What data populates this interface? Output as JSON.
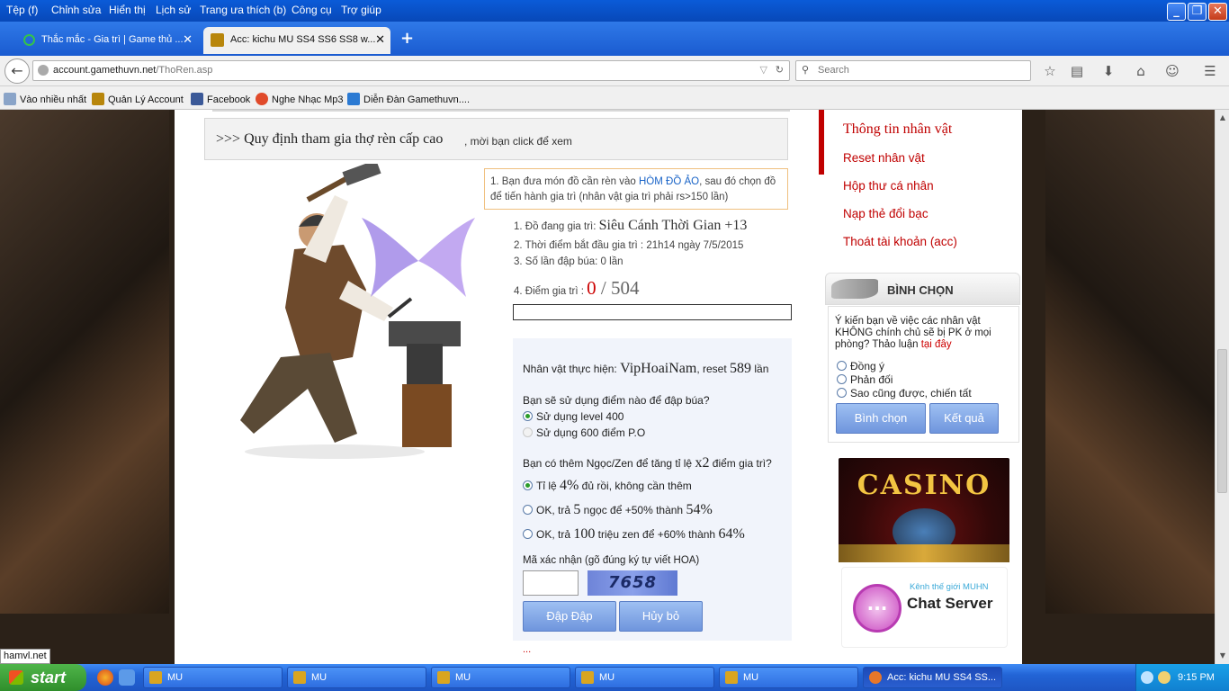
{
  "menubar": {
    "items": [
      "Tệp (f)",
      "Chỉnh sửa",
      "Hiển thị",
      "Lịch sử",
      "Trang ưa thích (b)",
      "Công cụ",
      "Trợ giúp"
    ]
  },
  "tabs": [
    {
      "label": "Thắc mắc - Gia trì | Game thủ ..."
    },
    {
      "label": "Acc: kichu MU SS4 SS6 SS8 w..."
    }
  ],
  "nav": {
    "url_domain": "account.gamethuvn.net",
    "url_path": "/ThoRen.asp",
    "search_placeholder": "Search"
  },
  "bookmarks": [
    "Vào nhiều nhất",
    "Quản Lý Account",
    "Facebook",
    "Nghe Nhạc Mp3",
    "Diễn Đàn Gamethuvn...."
  ],
  "notice": {
    "prefix": ">>> Quy định tham gia thợ rèn cấp cao",
    "suffix": ", mời bạn click để xem"
  },
  "note": {
    "part1": "1. Bạn đưa món đồ cần rèn vào ",
    "link": "HÒM ĐỒ ẢO",
    "part2": ", sau đó chọn đồ để tiến hành gia trì (nhân vật gia trì phải rs>150 lần)"
  },
  "info": {
    "item_label": "1. Đồ đang gia trì: ",
    "item_name": "Siêu Cánh Thời Gian +13",
    "start_time": "2. Thời điểm bắt đầu gia trì : 21h14 ngày 7/5/2015",
    "hammer_count": "3. Số lần đập búa: 0 lần",
    "points_label": "4. Điểm gia trì : ",
    "points_current": "0",
    "points_sep": " / ",
    "points_total": "504"
  },
  "progress": {
    "value": 0,
    "max": 504
  },
  "panel": {
    "char_label": "Nhân vật thực hiện: ",
    "char_name": "VipHoaiNam",
    "reset_label": ", reset ",
    "reset_value": "589",
    "reset_suffix": " lần",
    "q1": "Bạn sẽ sử dụng điểm nào để đập búa?",
    "opt1": "Sử dụng level 400",
    "opt2": "Sử dụng 600 điểm P.O",
    "q2_a": "Bạn có thêm Ngọc/Zen để tăng tỉ lệ ",
    "q2_x": "x2",
    "q2_b": " điểm gia trì?",
    "r1_a": "Tỉ lệ ",
    "r1_pct": "4%",
    "r1_b": " đủ rồi, không cần thêm",
    "r2_a": "OK, trả ",
    "r2_n": "5",
    "r2_b": " ngọc để +50% thành ",
    "r2_pct": "54%",
    "r3_a": "OK, trả ",
    "r3_n": "100",
    "r3_b": " triệu zen để +60% thành ",
    "r3_pct": "64%",
    "captcha_label": "Mã xác nhận (gõ đúng ký tự viết HOA)",
    "captcha_text": "7658",
    "btn_submit": "Đập Đập",
    "btn_cancel": "Hủy bỏ"
  },
  "dots": "...",
  "sidebar": {
    "menu": [
      "Thông tin nhân vật",
      "Reset nhân vật",
      "Hộp thư cá nhân",
      "Nạp thẻ đổi bạc",
      "Thoát tài khoản (acc)"
    ],
    "vote_title": "BÌNH CHỌN",
    "vote_question": "Ý kiến bạn về việc các nhân vật KHÔNG chính chủ sẽ bị PK ở mọi phòng? Thảo luận ",
    "vote_link": "tại đây",
    "vote_options": [
      "Đồng ý",
      "Phản đối",
      "Sao cũng được, chiến tất"
    ],
    "btn_vote": "Bình chọn",
    "btn_result": "Kết quả",
    "casino_text": "CASINO",
    "chat_sub": "Kênh thế giới MUHN",
    "chat_title": "Chat Server"
  },
  "status_tip": "hamvl.net",
  "taskbar": {
    "start": "start",
    "items": [
      "MU",
      "MU",
      "MU",
      "MU",
      "MU",
      "Acc: kichu MU SS4 SS..."
    ],
    "clock": "9:15 PM"
  }
}
